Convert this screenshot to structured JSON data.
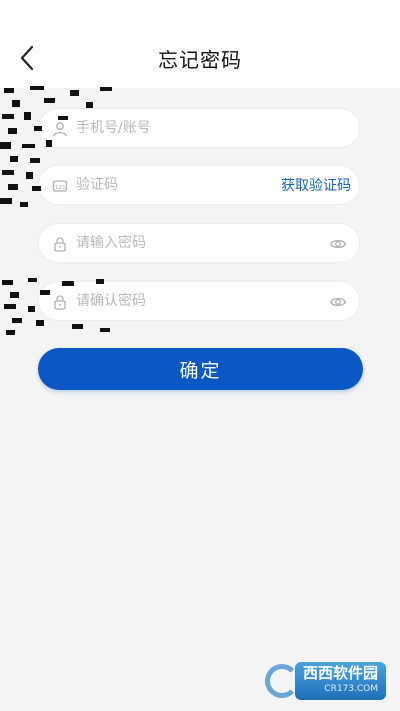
{
  "header": {
    "title": "忘记密码"
  },
  "form": {
    "phone_placeholder": "手机号/账号",
    "code_placeholder": "验证码",
    "get_code_label": "获取验证码",
    "password_placeholder": "请输入密码",
    "confirm_password_placeholder": "请确认密码",
    "confirm_label": "确定"
  },
  "icons": {
    "back": "chevron-left-icon",
    "phone": "user-icon",
    "code": "code-icon",
    "password": "lock-icon",
    "eye": "eye-icon"
  },
  "colors": {
    "accent": "#0b57c4",
    "link": "#1565c0",
    "background": "#f4f4f4"
  },
  "watermark": {
    "brand": "西西软件园",
    "url": "CR173.COM"
  }
}
